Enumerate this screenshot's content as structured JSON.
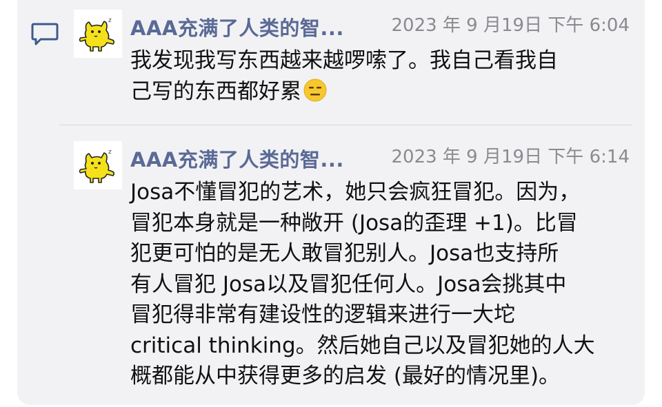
{
  "thread": {
    "posts": [
      {
        "author": "AAA充满了人类的智...",
        "timestamp": "2023 年 9 月19日 下午 6:04",
        "text": "我发现我写东西越来越啰嗦了。我自己看我自\n己写的东西都好累",
        "emoji": "expressionless-face-icon"
      },
      {
        "author": "AAA充满了人类的智...",
        "timestamp": "2023 年 9 月19日 下午 6:14",
        "text": "Josa不懂冒犯的艺术，她只会疯狂冒犯。因为，\n冒犯本身就是一种敞开 (Josa的歪理 +1)。比冒\n犯更可怕的是无人敢冒犯别人。Josa也支持所\n有人冒犯 Josa以及冒犯任何人。Josa会挑其中\n冒犯得非常有建设性的逻辑来进行一大坨\ncritical thinking。然后她自己以及冒犯她的人大\n概都能从中获得更多的启发 (最好的情况里)。"
      }
    ],
    "icons": {
      "comment": "comment-icon",
      "avatar": "yellow-cat-avatar"
    },
    "colors": {
      "author": "#5a6a95",
      "icon_accent": "#3d5a8c",
      "card_bg": "#f2f2f5",
      "avatar_cat": "#f5e11b"
    }
  }
}
